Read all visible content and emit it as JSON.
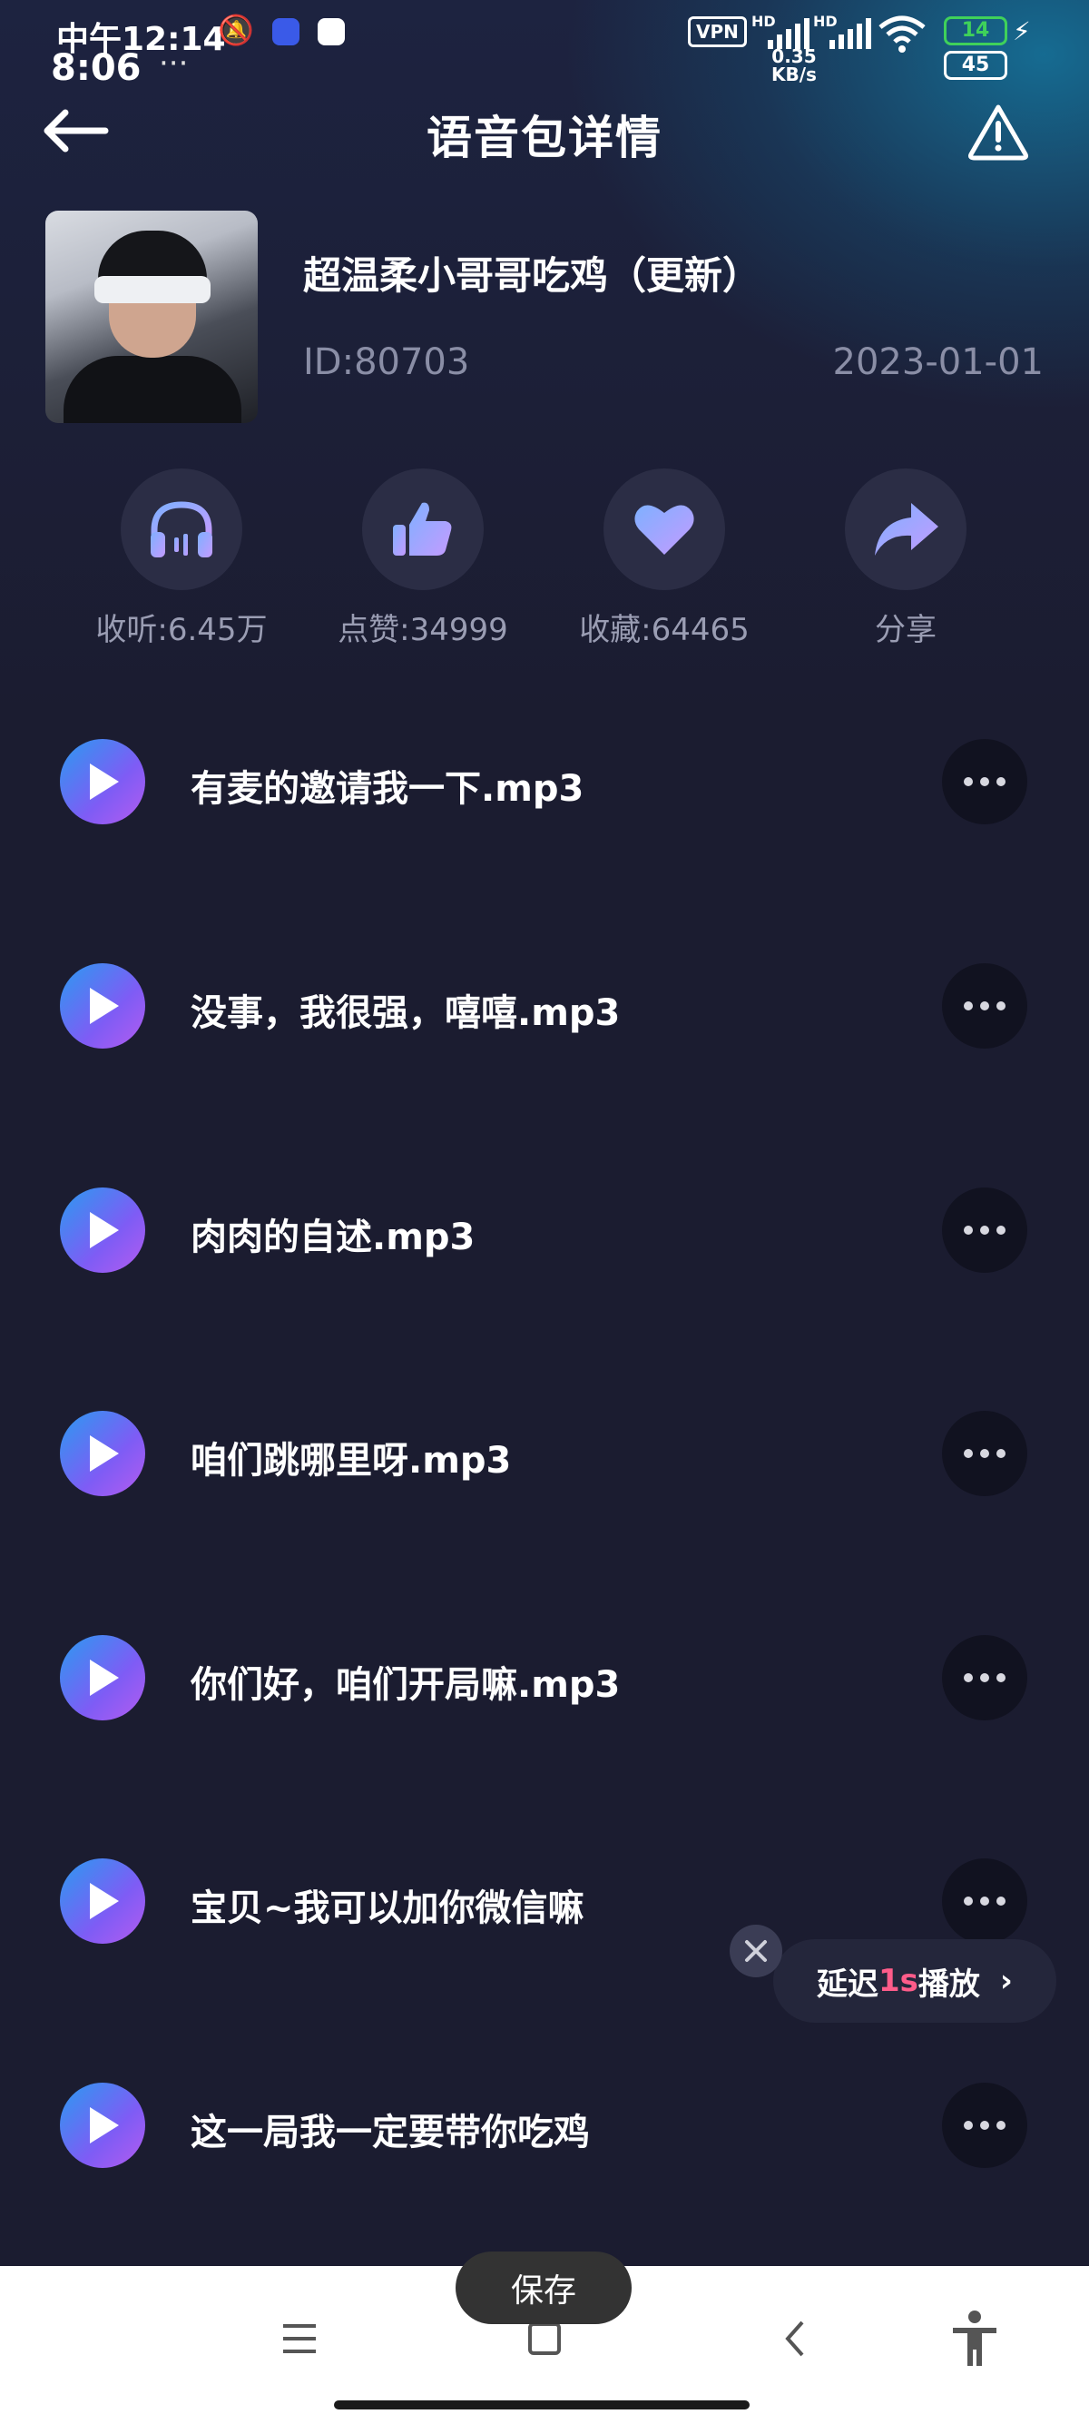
{
  "status_bar": {
    "time_primary": "中午12:14",
    "time_secondary": "8:06",
    "dots": "···",
    "vpn": "VPN",
    "speed_value": "0.35",
    "speed_unit": "KB/s",
    "hd1": "HD",
    "hd2": "HD",
    "battery1": "14",
    "battery2": "45"
  },
  "header": {
    "title": "语音包详情",
    "back_icon": "arrow-left-icon",
    "report_icon": "warning-triangle-icon"
  },
  "pack": {
    "title": "超温柔小哥哥吃鸡（更新）",
    "id": "ID:80703",
    "date": "2023-01-01"
  },
  "stats": [
    {
      "icon": "headphones-icon",
      "label": "收听:6.45万"
    },
    {
      "icon": "thumbs-up-icon",
      "label": "点赞:34999"
    },
    {
      "icon": "heart-icon",
      "label": "收藏:64465"
    },
    {
      "icon": "share-icon",
      "label": "分享"
    }
  ],
  "tracks": [
    {
      "name": "有麦的邀请我一下.mp3"
    },
    {
      "name": "没事，我很强，嘻嘻.mp3"
    },
    {
      "name": "肉肉的自述.mp3"
    },
    {
      "name": "咱们跳哪里呀.mp3"
    },
    {
      "name": "你们好，咱们开局嘛.mp3"
    },
    {
      "name": "宝贝~我可以加你微信嘛"
    },
    {
      "name": "这一局我一定要带你吃鸡"
    }
  ],
  "delay_toast": {
    "prefix": "延迟",
    "value": "1s",
    "suffix": "播放",
    "chevron": "›"
  },
  "save_label": "保存",
  "nav": {
    "items": [
      "menu-icon",
      "home-icon",
      "back-icon",
      "accessibility-icon"
    ]
  },
  "colors": {
    "background": "#1b1c30",
    "accent_pink": "#ff5c8a",
    "play_gradient_start": "#2a9bf0",
    "play_gradient_end": "#b45cf0"
  }
}
